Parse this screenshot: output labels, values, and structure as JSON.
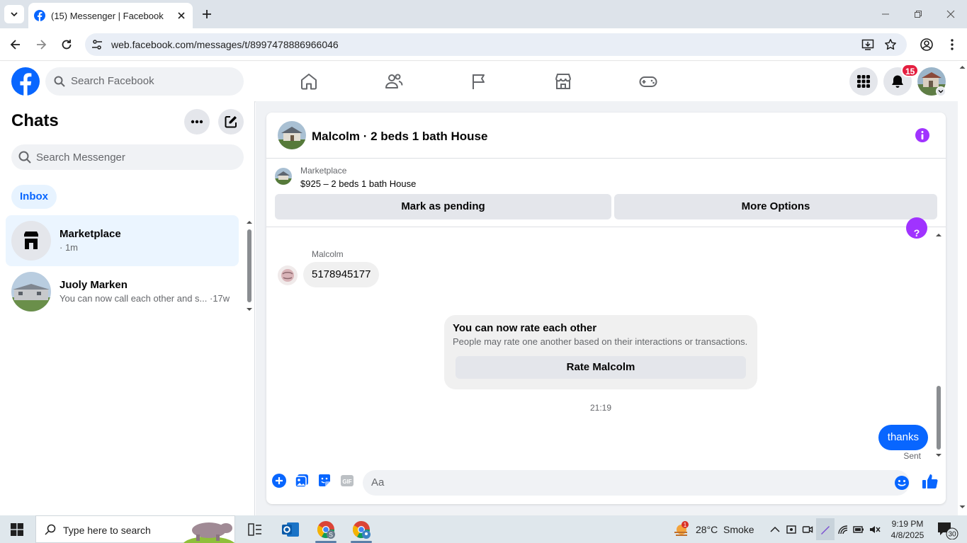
{
  "browser": {
    "tab_title": "(15) Messenger | Facebook",
    "url": "web.facebook.com/messages/t/8997478886966046"
  },
  "facebook": {
    "search_placeholder": "Search Facebook",
    "notification_count": "15",
    "brand_color": "#0866ff"
  },
  "sidebar": {
    "title": "Chats",
    "search_placeholder": "Search Messenger",
    "filter_inbox": "Inbox",
    "conversations": [
      {
        "name": "Marketplace",
        "preview": "· 1m"
      },
      {
        "name": "Juoly Marken",
        "preview": "You can now call each other and s... ·17w"
      }
    ]
  },
  "conversation": {
    "header_title": "Malcolm · 2 beds 1 bath House",
    "banner_label": "Marketplace",
    "banner_listing": "$925 – 2 beds 1 bath House",
    "mark_pending_label": "Mark as pending",
    "more_options_label": "More Options",
    "sender_name": "Malcolm",
    "incoming_message": "5178945177",
    "rate_card": {
      "heading": "You can now rate each other",
      "description": "People may rate one another based on their interactions or transactions.",
      "button_label": "Rate Malcolm"
    },
    "timestamp": "21:19",
    "outgoing_message": "thanks",
    "delivery_status": "Sent",
    "composer_placeholder": "Aa"
  },
  "taskbar": {
    "search_placeholder": "Type here to search",
    "weather_temp": "28°C",
    "weather_desc": "Smoke",
    "weather_alert_count": "1",
    "time": "9:19 PM",
    "date": "4/8/2025",
    "notification_count": "30"
  }
}
